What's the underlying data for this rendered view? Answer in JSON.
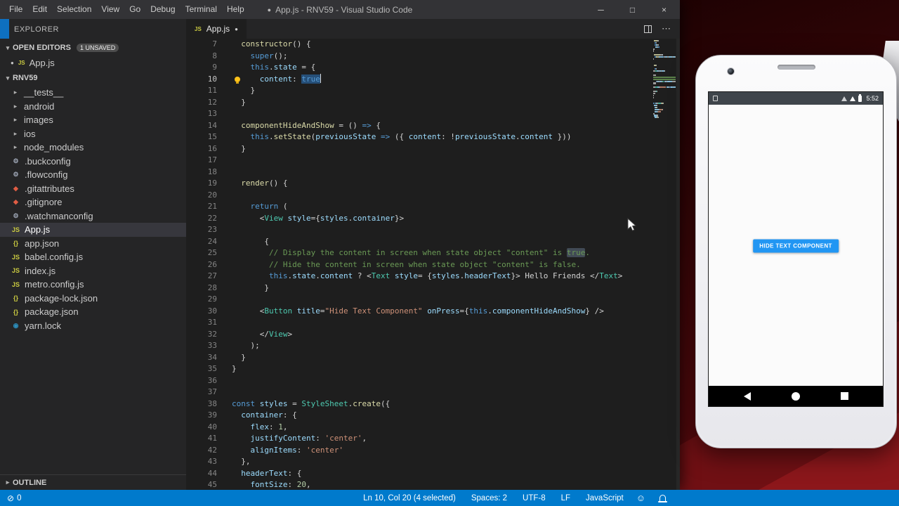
{
  "titlebar": {
    "menus": [
      "File",
      "Edit",
      "Selection",
      "View",
      "Go",
      "Debug",
      "Terminal",
      "Help"
    ],
    "modified_dot": "●",
    "title": "App.js - RNV59 - Visual Studio Code",
    "window_controls": {
      "minimize": "─",
      "maximize": "□",
      "close": "×"
    }
  },
  "sidebar": {
    "explorer_title": "EXPLORER",
    "open_editors": {
      "label": "OPEN EDITORS",
      "badge": "1 UNSAVED",
      "items": [
        {
          "name": "App.js",
          "icon": "js",
          "modified_dot": "●"
        }
      ]
    },
    "project": {
      "name": "RNV59",
      "items": [
        {
          "name": "__tests__",
          "type": "folder"
        },
        {
          "name": "android",
          "type": "folder"
        },
        {
          "name": "images",
          "type": "folder"
        },
        {
          "name": "ios",
          "type": "folder"
        },
        {
          "name": "node_modules",
          "type": "folder"
        },
        {
          "name": ".buckconfig",
          "type": "config"
        },
        {
          "name": ".flowconfig",
          "type": "config"
        },
        {
          "name": ".gitattributes",
          "type": "git"
        },
        {
          "name": ".gitignore",
          "type": "git"
        },
        {
          "name": ".watchmanconfig",
          "type": "config"
        },
        {
          "name": "App.js",
          "type": "js",
          "selected": true
        },
        {
          "name": "app.json",
          "type": "json"
        },
        {
          "name": "babel.config.js",
          "type": "js"
        },
        {
          "name": "index.js",
          "type": "js"
        },
        {
          "name": "metro.config.js",
          "type": "js"
        },
        {
          "name": "package-lock.json",
          "type": "json"
        },
        {
          "name": "package.json",
          "type": "json"
        },
        {
          "name": "yarn.lock",
          "type": "lock"
        }
      ]
    },
    "outline_label": "OUTLINE"
  },
  "editor": {
    "tab": {
      "label": "App.js",
      "icon": "js",
      "modified_dot": "●"
    },
    "first_line": 7,
    "active_line": 10,
    "lines": [
      [
        [
          "p",
          "  "
        ],
        [
          "f",
          "constructor"
        ],
        [
          "p",
          "() {"
        ]
      ],
      [
        [
          "p",
          "    "
        ],
        [
          "k",
          "super"
        ],
        [
          "p",
          "();"
        ]
      ],
      [
        [
          "p",
          "    "
        ],
        [
          "k",
          "this"
        ],
        [
          "p",
          "."
        ],
        [
          "v",
          "state"
        ],
        [
          "p",
          " = {"
        ]
      ],
      [
        [
          "p",
          "      "
        ],
        [
          "v",
          "content"
        ],
        [
          "p",
          ": "
        ],
        [
          "k sel",
          "true"
        ],
        [
          "cur",
          ""
        ]
      ],
      [
        [
          "p",
          "    }"
        ]
      ],
      [
        [
          "p",
          "  }"
        ]
      ],
      [],
      [
        [
          "p",
          "  "
        ],
        [
          "f",
          "componentHideAndShow"
        ],
        [
          "p",
          " = () "
        ],
        [
          "k",
          "=>"
        ],
        [
          "p",
          " {"
        ]
      ],
      [
        [
          "p",
          "    "
        ],
        [
          "k",
          "this"
        ],
        [
          "p",
          "."
        ],
        [
          "f",
          "setState"
        ],
        [
          "p",
          "("
        ],
        [
          "v",
          "previousState"
        ],
        [
          "p",
          " "
        ],
        [
          "k",
          "=>"
        ],
        [
          "p",
          " ({ "
        ],
        [
          "v",
          "content"
        ],
        [
          "p",
          ": !"
        ],
        [
          "v",
          "previousState"
        ],
        [
          "p",
          "."
        ],
        [
          "v",
          "content"
        ],
        [
          "p",
          " }))"
        ]
      ],
      [
        [
          "p",
          "  }"
        ]
      ],
      [],
      [],
      [
        [
          "p",
          "  "
        ],
        [
          "f",
          "render"
        ],
        [
          "p",
          "() {"
        ]
      ],
      [],
      [
        [
          "p",
          "    "
        ],
        [
          "k",
          "return"
        ],
        [
          "p",
          " ("
        ]
      ],
      [
        [
          "p",
          "      <"
        ],
        [
          "t",
          "View"
        ],
        [
          "p",
          " "
        ],
        [
          "v",
          "style"
        ],
        [
          "p",
          "={"
        ],
        [
          "v",
          "styles"
        ],
        [
          "p",
          "."
        ],
        [
          "v",
          "container"
        ],
        [
          "p",
          "}>"
        ]
      ],
      [],
      [
        [
          "p",
          "       {"
        ]
      ],
      [
        [
          "c",
          "        // Display the content in screen when state object \"content\" is "
        ],
        [
          "c hl",
          "true"
        ],
        [
          "c",
          "."
        ]
      ],
      [
        [
          "c",
          "        // Hide the content in screen when state object \"content\" is false."
        ]
      ],
      [
        [
          "p",
          "        "
        ],
        [
          "k",
          "this"
        ],
        [
          "p",
          "."
        ],
        [
          "v",
          "state"
        ],
        [
          "p",
          "."
        ],
        [
          "v",
          "content"
        ],
        [
          "p",
          " ? <"
        ],
        [
          "t",
          "Text"
        ],
        [
          "p",
          " "
        ],
        [
          "v",
          "style"
        ],
        [
          "p",
          "= {"
        ],
        [
          "v",
          "styles"
        ],
        [
          "p",
          "."
        ],
        [
          "v",
          "headerText"
        ],
        [
          "p",
          "}> Hello Friends </"
        ],
        [
          "t",
          "Text"
        ],
        [
          "p",
          ">"
        ]
      ],
      [
        [
          "p",
          "       }"
        ]
      ],
      [],
      [
        [
          "p",
          "      <"
        ],
        [
          "t",
          "Button"
        ],
        [
          "p",
          " "
        ],
        [
          "v",
          "title"
        ],
        [
          "p",
          "="
        ],
        [
          "s",
          "\"Hide Text Component\""
        ],
        [
          "p",
          " "
        ],
        [
          "v",
          "onPress"
        ],
        [
          "p",
          "={"
        ],
        [
          "k",
          "this"
        ],
        [
          "p",
          "."
        ],
        [
          "v",
          "componentHideAndShow"
        ],
        [
          "p",
          "} />"
        ]
      ],
      [],
      [
        [
          "p",
          "      </"
        ],
        [
          "t",
          "View"
        ],
        [
          "p",
          ">"
        ]
      ],
      [
        [
          "p",
          "    );"
        ]
      ],
      [
        [
          "p",
          "  }"
        ]
      ],
      [
        [
          "p",
          "}"
        ]
      ],
      [],
      [],
      [
        [
          "k",
          "const"
        ],
        [
          "p",
          " "
        ],
        [
          "v",
          "styles"
        ],
        [
          "p",
          " = "
        ],
        [
          "t",
          "StyleSheet"
        ],
        [
          "p",
          "."
        ],
        [
          "f",
          "create"
        ],
        [
          "p",
          "({"
        ]
      ],
      [
        [
          "p",
          "  "
        ],
        [
          "v",
          "container"
        ],
        [
          "p",
          ": {"
        ]
      ],
      [
        [
          "p",
          "    "
        ],
        [
          "v",
          "flex"
        ],
        [
          "p",
          ": "
        ],
        [
          "n",
          "1"
        ],
        [
          "p",
          ","
        ]
      ],
      [
        [
          "p",
          "    "
        ],
        [
          "v",
          "justifyContent"
        ],
        [
          "p",
          ": "
        ],
        [
          "s",
          "'center'"
        ],
        [
          "p",
          ","
        ]
      ],
      [
        [
          "p",
          "    "
        ],
        [
          "v",
          "alignItems"
        ],
        [
          "p",
          ": "
        ],
        [
          "s",
          "'center'"
        ]
      ],
      [
        [
          "p",
          "  },"
        ]
      ],
      [
        [
          "p",
          "  "
        ],
        [
          "v",
          "headerText"
        ],
        [
          "p",
          ": {"
        ]
      ],
      [
        [
          "p",
          "    "
        ],
        [
          "v",
          "fontSize"
        ],
        [
          "p",
          ": "
        ],
        [
          "n",
          "20"
        ],
        [
          "p",
          ","
        ]
      ]
    ]
  },
  "status_bar": {
    "problems": {
      "count": "0"
    },
    "right_items": [
      "Ln 10, Col 20 (4 selected)",
      "Spaces: 2",
      "UTF-8",
      "LF",
      "JavaScript"
    ]
  },
  "emulator": {
    "status_time": "5:52",
    "button_label": "HIDE TEXT COMPONENT",
    "button_color": "#2196f3"
  },
  "colors": {
    "status_bar": "#007acc",
    "selection": "#264f78",
    "editor_bg": "#1e1e1e",
    "sidebar_bg": "#252526"
  }
}
